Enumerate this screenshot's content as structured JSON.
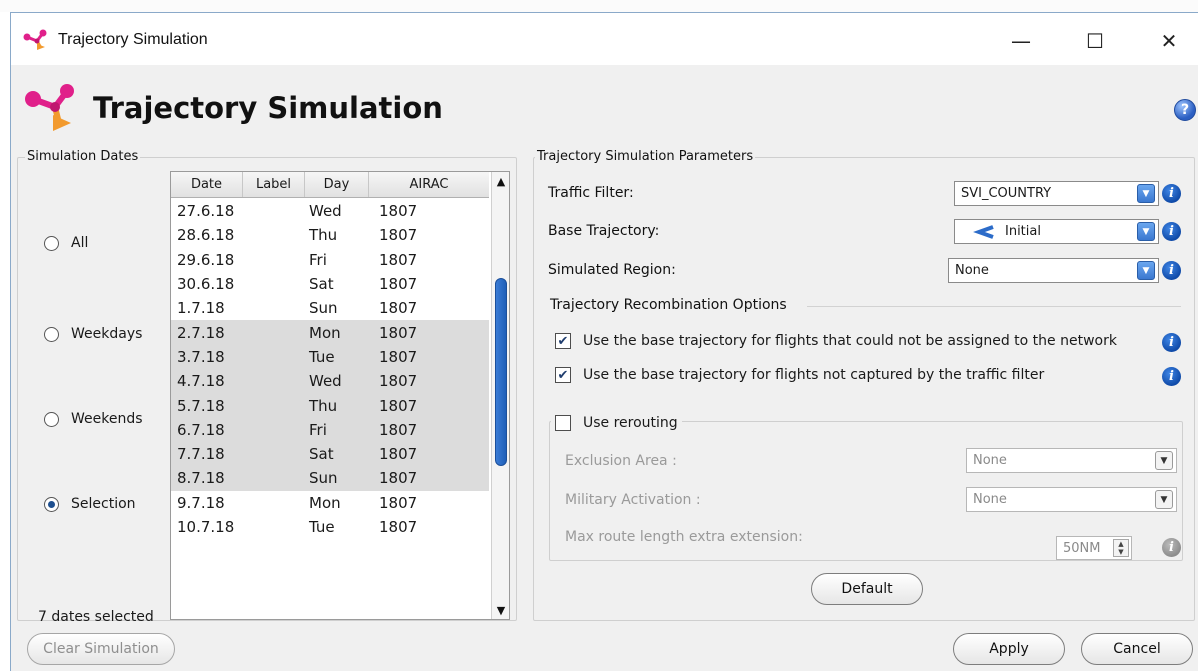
{
  "window": {
    "title": "Trajectory Simulation",
    "minimize_glyph": "—",
    "maximize_glyph": "☐",
    "close_glyph": "✕"
  },
  "header": {
    "title": "Trajectory Simulation",
    "help_glyph": "?"
  },
  "dates_panel": {
    "group_label": "Simulation Dates",
    "radios": [
      {
        "label": "All",
        "checked": false
      },
      {
        "label": "Weekdays",
        "checked": false
      },
      {
        "label": "Weekends",
        "checked": false
      },
      {
        "label": "Selection",
        "checked": true
      }
    ],
    "columns": [
      "Date",
      "Label",
      "Day",
      "AIRAC"
    ],
    "rows": [
      {
        "date": "27.6.18",
        "label": "",
        "day": "Wed",
        "airac": "1807",
        "selected": false
      },
      {
        "date": "28.6.18",
        "label": "",
        "day": "Thu",
        "airac": "1807",
        "selected": false
      },
      {
        "date": "29.6.18",
        "label": "",
        "day": "Fri",
        "airac": "1807",
        "selected": false
      },
      {
        "date": "30.6.18",
        "label": "",
        "day": "Sat",
        "airac": "1807",
        "selected": false
      },
      {
        "date": "1.7.18",
        "label": "",
        "day": "Sun",
        "airac": "1807",
        "selected": false
      },
      {
        "date": "2.7.18",
        "label": "",
        "day": "Mon",
        "airac": "1807",
        "selected": true
      },
      {
        "date": "3.7.18",
        "label": "",
        "day": "Tue",
        "airac": "1807",
        "selected": true
      },
      {
        "date": "4.7.18",
        "label": "",
        "day": "Wed",
        "airac": "1807",
        "selected": true
      },
      {
        "date": "5.7.18",
        "label": "",
        "day": "Thu",
        "airac": "1807",
        "selected": true
      },
      {
        "date": "6.7.18",
        "label": "",
        "day": "Fri",
        "airac": "1807",
        "selected": true
      },
      {
        "date": "7.7.18",
        "label": "",
        "day": "Sat",
        "airac": "1807",
        "selected": true
      },
      {
        "date": "8.7.18",
        "label": "",
        "day": "Sun",
        "airac": "1807",
        "selected": true
      },
      {
        "date": "9.7.18",
        "label": "",
        "day": "Mon",
        "airac": "1807",
        "selected": false
      },
      {
        "date": "10.7.18",
        "label": "",
        "day": "Tue",
        "airac": "1807",
        "selected": false
      }
    ],
    "scroll_up_glyph": "▲",
    "scroll_down_glyph": "▼",
    "count_text": "7 dates selected"
  },
  "params": {
    "group_label": "Trajectory Simulation Parameters",
    "traffic_filter": {
      "label": "Traffic Filter:",
      "value": "SVI_COUNTRY"
    },
    "base_trajectory": {
      "label": "Base Trajectory:",
      "value": "Initial"
    },
    "simulated_region": {
      "label": "Simulated Region:",
      "value": "None"
    },
    "recombination": {
      "group_label": "Trajectory Recombination Options",
      "option1": {
        "label": "Use the base trajectory for flights that could not be assigned to the network",
        "checked": true
      },
      "option2": {
        "label": "Use the base trajectory for flights not captured by the traffic filter",
        "checked": true
      }
    },
    "rerouting": {
      "label": "Use rerouting",
      "checked": false,
      "exclusion_area": {
        "label": "Exclusion Area :",
        "value": "None"
      },
      "military_activation": {
        "label": "Military Activation :",
        "value": "None"
      },
      "max_route_length": {
        "label": "Max route length extra extension:",
        "value": "50NM"
      }
    },
    "default_button": "Default"
  },
  "footer": {
    "clear_button": "Clear Simulation",
    "apply_button": "Apply",
    "cancel_button": "Cancel"
  },
  "colors": {
    "accent": "#2c6cc9",
    "selected_row": "#dcdcdc",
    "logo_magenta": "#e0208a",
    "logo_orange": "#f29a2e"
  },
  "icons": {
    "logo": "trajectory-logo-icon",
    "help": "help-icon",
    "info": "info-icon",
    "dropdown": "chevron-down-icon"
  },
  "glyphs": {
    "checkmark": "✔",
    "dropdown": "▼",
    "info": "i",
    "spin_up": "▲",
    "spin_down": "▼"
  }
}
